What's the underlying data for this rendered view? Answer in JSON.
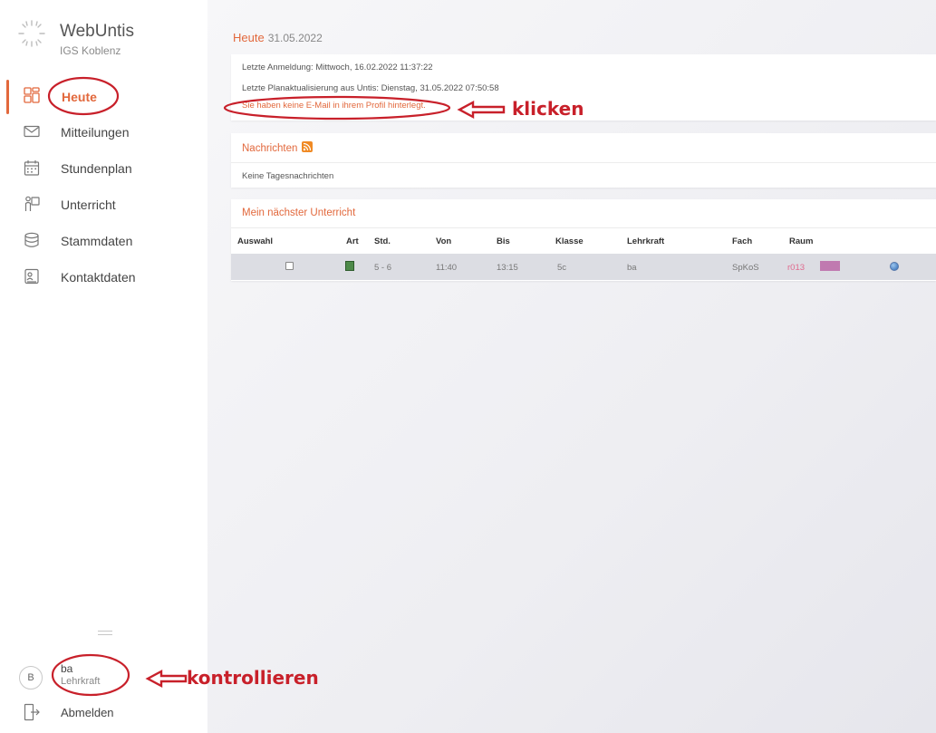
{
  "app": {
    "title": "WebUntis",
    "school": "IGS Koblenz"
  },
  "sidebar": {
    "items": [
      {
        "label": "Heute",
        "icon": "dashboard-grid-icon",
        "active": true
      },
      {
        "label": "Mitteilungen",
        "icon": "envelope-icon",
        "active": false
      },
      {
        "label": "Stundenplan",
        "icon": "calendar-icon",
        "active": false
      },
      {
        "label": "Unterricht",
        "icon": "teacher-board-icon",
        "active": false
      },
      {
        "label": "Stammdaten",
        "icon": "database-icon",
        "active": false
      },
      {
        "label": "Kontaktdaten",
        "icon": "contact-card-icon",
        "active": false
      }
    ],
    "user": {
      "avatar": "B",
      "name": "ba",
      "role": "Lehrkraft"
    },
    "logout_label": "Abmelden"
  },
  "main": {
    "title": "Heute",
    "date": "31.05.2022",
    "info": {
      "last_login": "Letzte Anmeldung: Mittwoch, 16.02.2022 11:37:22",
      "last_update": "Letzte Planaktualisierung aus Untis: Dienstag, 31.05.2022 07:50:58",
      "email_notice": "Sie haben keine E-Mail in ihrem Profil hinterlegt."
    },
    "news": {
      "header": "Nachrichten",
      "empty": "Keine Tagesnachrichten"
    },
    "lessons": {
      "header": "Mein nächster Unterricht",
      "columns": [
        "Auswahl",
        "Art",
        "Std.",
        "Von",
        "Bis",
        "Klasse",
        "Lehrkraft",
        "Fach",
        "Raum"
      ],
      "rows": [
        {
          "std": "5 - 6",
          "von": "11:40",
          "bis": "13:15",
          "klasse": "5c",
          "lehrkraft": "ba",
          "fach": "SpKoS",
          "raum": "r013"
        }
      ]
    }
  },
  "annotations": {
    "click": "klicken",
    "check": "kontrollieren",
    "color": "#c8202a"
  },
  "colors": {
    "accent": "#e2683c",
    "row_bg": "#dcdde3"
  }
}
